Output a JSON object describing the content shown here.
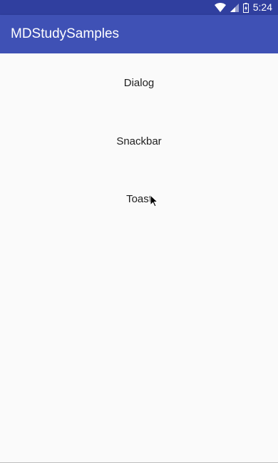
{
  "status_bar": {
    "time": "5:24",
    "icons": [
      "wifi-icon",
      "signal-icon",
      "battery-icon"
    ]
  },
  "app_bar": {
    "title": "MDStudySamples"
  },
  "buttons": {
    "dialog": "Dialog",
    "snackbar": "Snackbar",
    "toast": "Toast"
  },
  "colors": {
    "primary": "#3f51b5",
    "primary_dark": "#303f9f",
    "background": "#fafafa",
    "text": "#212121"
  }
}
